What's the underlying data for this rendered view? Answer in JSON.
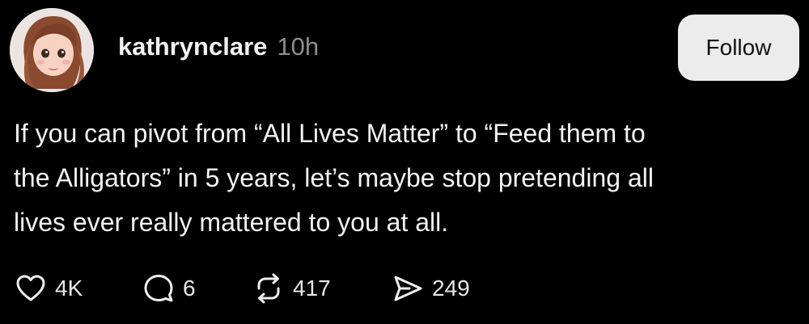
{
  "post": {
    "author": "kathrynclare",
    "time": "10h",
    "follow_label": "Follow",
    "lines": [
      "If you can pivot from “All Lives Matter” to “Feed them to",
      "the Alligators” in 5 years, let’s maybe stop pretending all",
      "lives ever really mattered to you at all."
    ],
    "actions": {
      "likes": "4K",
      "comments": "6",
      "reposts": "417",
      "shares": "249"
    }
  },
  "icons": {
    "like": "heart-icon",
    "comment": "comment-bubble-icon",
    "repost": "repost-arrows-icon",
    "share": "send-paper-plane-icon"
  },
  "colors": {
    "background": "#000000",
    "text": "#f3f3f3",
    "muted": "#8e8e8e",
    "follow_button_bg": "#ececec"
  }
}
